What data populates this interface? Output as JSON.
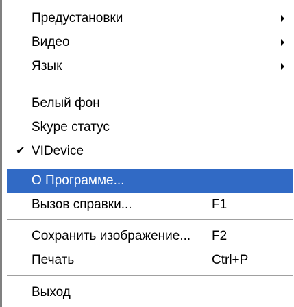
{
  "menu": {
    "highlight_color": "#316ac5",
    "items": [
      {
        "label": "Предустановки",
        "submenu": true
      },
      {
        "label": "Видео",
        "submenu": true
      },
      {
        "label": "Язык",
        "submenu": true
      },
      {
        "label": "Белый фон"
      },
      {
        "label": "Skype статус"
      },
      {
        "label": "VIDevice",
        "checked": true,
        "check_glyph": "✔"
      },
      {
        "label": "О Программе...",
        "highlighted": true
      },
      {
        "label": "Вызов справки...",
        "shortcut": "F1"
      },
      {
        "label": "Сохранить изображение...",
        "shortcut": "F2"
      },
      {
        "label": "Печать",
        "shortcut": "Ctrl+P"
      },
      {
        "label": "Выход"
      }
    ]
  }
}
